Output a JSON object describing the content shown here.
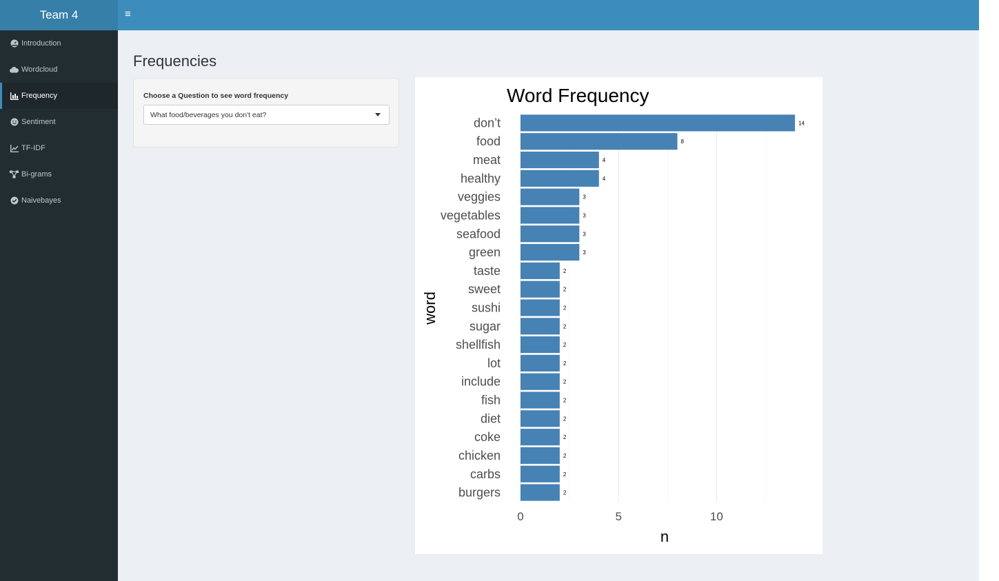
{
  "app": {
    "title": "Team 4"
  },
  "header": {
    "menu_icon": "hamburger-icon"
  },
  "sidebar": {
    "items": [
      {
        "label": "Introduction",
        "icon": "dashboard-icon"
      },
      {
        "label": "Wordcloud",
        "icon": "cloud-icon"
      },
      {
        "label": "Frequency",
        "icon": "bar-chart-icon",
        "active": true
      },
      {
        "label": "Sentiment",
        "icon": "smile-icon"
      },
      {
        "label": "TF-IDF",
        "icon": "line-chart-icon"
      },
      {
        "label": "Bi-grams",
        "icon": "network-icon"
      },
      {
        "label": "Naivebayes",
        "icon": "check-circle-icon"
      }
    ]
  },
  "main": {
    "title": "Frequencies",
    "question": {
      "label": "Choose a Question to see word frequency",
      "selected": "What food/beverages you don't eat?"
    }
  },
  "colors": {
    "bar": "#4682b4",
    "header": "#3c8dbc",
    "logo": "#367fa9",
    "sidebar": "#222d32"
  },
  "chart_data": {
    "type": "bar",
    "orientation": "horizontal",
    "title": "Word Frequency",
    "xlabel": "n",
    "ylabel": "word",
    "categories": [
      "don’t",
      "food",
      "meat",
      "healthy",
      "veggies",
      "vegetables",
      "seafood",
      "green",
      "taste",
      "sweet",
      "sushi",
      "sugar",
      "shellfish",
      "lot",
      "include",
      "fish",
      "diet",
      "coke",
      "chicken",
      "carbs",
      "burgers"
    ],
    "values": [
      14,
      8,
      4,
      4,
      3,
      3,
      3,
      3,
      2,
      2,
      2,
      2,
      2,
      2,
      2,
      2,
      2,
      2,
      2,
      2,
      2
    ],
    "xticks": [
      0,
      5,
      10
    ],
    "xlim": [
      0,
      14.7
    ],
    "data_labels": true,
    "grid": true
  }
}
